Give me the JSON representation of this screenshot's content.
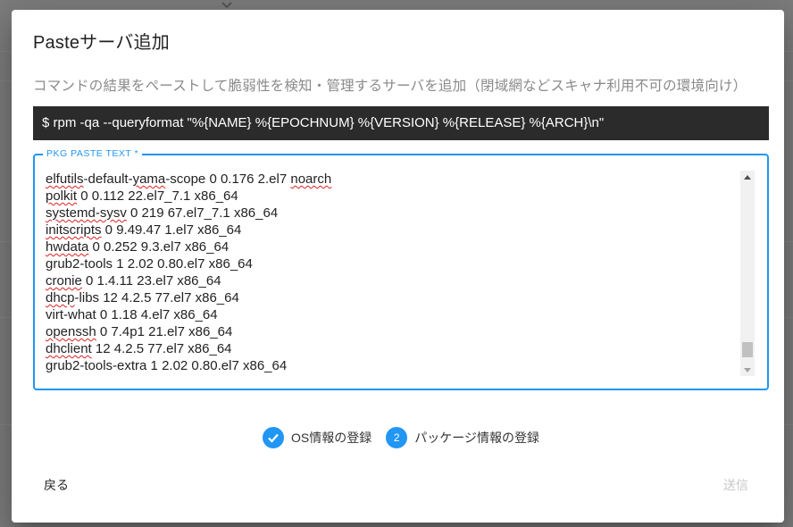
{
  "dialog": {
    "title": "Pasteサーバ追加",
    "subtitle": "コマンドの結果をペーストして脆弱性を検知・管理するサーバを追加（閉域網などスキャナ利用不可の環境向け）",
    "command": "$  rpm -qa --queryformat \"%{NAME} %{EPOCHNUM} %{VERSION} %{RELEASE} %{ARCH}\\n\""
  },
  "paste_field": {
    "label": "PKG PASTE TEXT *",
    "lines": [
      {
        "pre": "",
        "sp": "elfutils",
        "mid": "-default-",
        "sp2": "yama",
        "post": "-scope 0 0.176 2.el7 ",
        "sp3": "noarch"
      },
      {
        "pre": "",
        "sp": "polkit",
        "post": " 0 0.112 22.el7_7.1 x86_64"
      },
      {
        "pre": "",
        "sp": "systemd-sysv",
        "post": " 0 219 67.el7_7.1 x86_64"
      },
      {
        "pre": "",
        "sp": "initscripts",
        "post": " 0 9.49.47 1.el7 x86_64"
      },
      {
        "pre": "",
        "sp": "hwdata",
        "post": " 0 0.252 9.3.el7 x86_64"
      },
      {
        "pre": "grub2-tools 1 2.02 0.80.el7 x86_64",
        "sp": "",
        "post": ""
      },
      {
        "pre": "",
        "sp": "cronie",
        "post": " 0 1.4.11 23.el7 x86_64"
      },
      {
        "pre": "",
        "sp": "dhcp",
        "post": "-libs 12 4.2.5 77.el7 x86_64"
      },
      {
        "pre": "virt-what 0 1.18 4.el7 x86_64",
        "sp": "",
        "post": ""
      },
      {
        "pre": "",
        "sp": "openssh",
        "post": " 0 7.4p1 21.el7 x86_64"
      },
      {
        "pre": "",
        "sp": "dhclient",
        "post": " 12 4.2.5 77.el7 x86_64"
      },
      {
        "pre": "grub2-tools-extra 1 2.02 0.80.el7 x86_64",
        "sp": "",
        "post": ""
      }
    ],
    "scroll_position": 0.93
  },
  "stepper": {
    "steps": [
      {
        "number": "✓",
        "label": "OS情報の登録",
        "state": "completed"
      },
      {
        "number": "2",
        "label": "パッケージ情報の登録",
        "state": "active"
      }
    ]
  },
  "actions": {
    "back_label": "戻る",
    "send_label": "送信"
  },
  "colors": {
    "accent": "#2196f3",
    "command_bg": "#2b2b2b",
    "disabled_text": "#c7c7c7"
  }
}
